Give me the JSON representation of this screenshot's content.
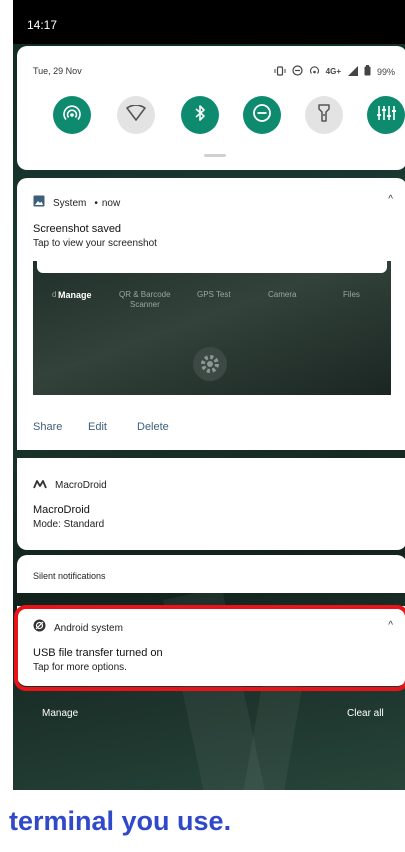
{
  "status_bar": {
    "time": "14:17"
  },
  "quick_settings": {
    "date": "Tue, 29 Nov",
    "network_type": "4G+",
    "battery": "99%",
    "tiles": [
      {
        "icon": "hotspot-icon",
        "state": "on"
      },
      {
        "icon": "wifi-icon",
        "state": "off"
      },
      {
        "icon": "bluetooth-icon",
        "state": "on"
      },
      {
        "icon": "do-not-disturb-icon",
        "state": "on"
      },
      {
        "icon": "flashlight-icon",
        "state": "off"
      },
      {
        "icon": "equalizer-icon",
        "state": "on"
      }
    ]
  },
  "notifications": {
    "system": {
      "app": "System",
      "time_sep": "•",
      "time": "now",
      "title": "Screenshot saved",
      "text": "Tap to view your screenshot",
      "preview": {
        "manage": "Manage",
        "labels": [
          "d",
          "QR & Barcode",
          "Scanner",
          "GPS Test",
          "Camera",
          "Files"
        ]
      },
      "actions": [
        "Share",
        "Edit",
        "Delete"
      ]
    },
    "macrodroid": {
      "app": "MacroDroid",
      "title": "MacroDroid",
      "text": "Mode: Standard"
    },
    "silent_header": "Silent notifications",
    "android_system": {
      "app": "Android system",
      "title": "USB file transfer turned on",
      "text": "Tap for more options."
    }
  },
  "bottom": {
    "manage": "Manage",
    "clear_all": "Clear all"
  },
  "caption": "terminal you use.",
  "colors": {
    "accent": "#0e8a6f",
    "highlight": "#e8141a",
    "caption": "#2f49c9",
    "link": "#3e5f7a"
  }
}
